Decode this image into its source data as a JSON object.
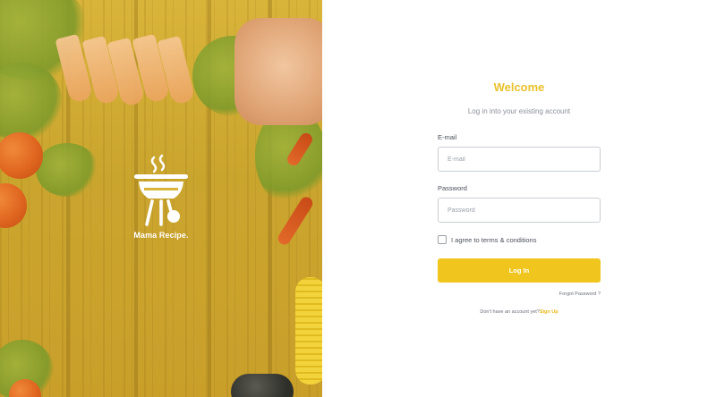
{
  "brand": {
    "name": "Mama Recipe.",
    "logo_icon": "grill-icon"
  },
  "login": {
    "title": "Welcome",
    "subtitle": "Log in into your existing account",
    "email_label": "E-mail",
    "email_placeholder": "E-mail",
    "email_value": "",
    "password_label": "Password",
    "password_placeholder": "Password",
    "password_value": "",
    "agree_text": "I agree to terms & conditions",
    "agree_checked": false,
    "login_label": "Log In",
    "forgot_label": "Forgot Password ?",
    "signup_prompt": "Don't have an account yet?",
    "signup_link": "Sign Up"
  },
  "colors": {
    "accent": "#f0c61e",
    "title": "#e8c12a",
    "hero_overlay": "#d9b43a"
  }
}
